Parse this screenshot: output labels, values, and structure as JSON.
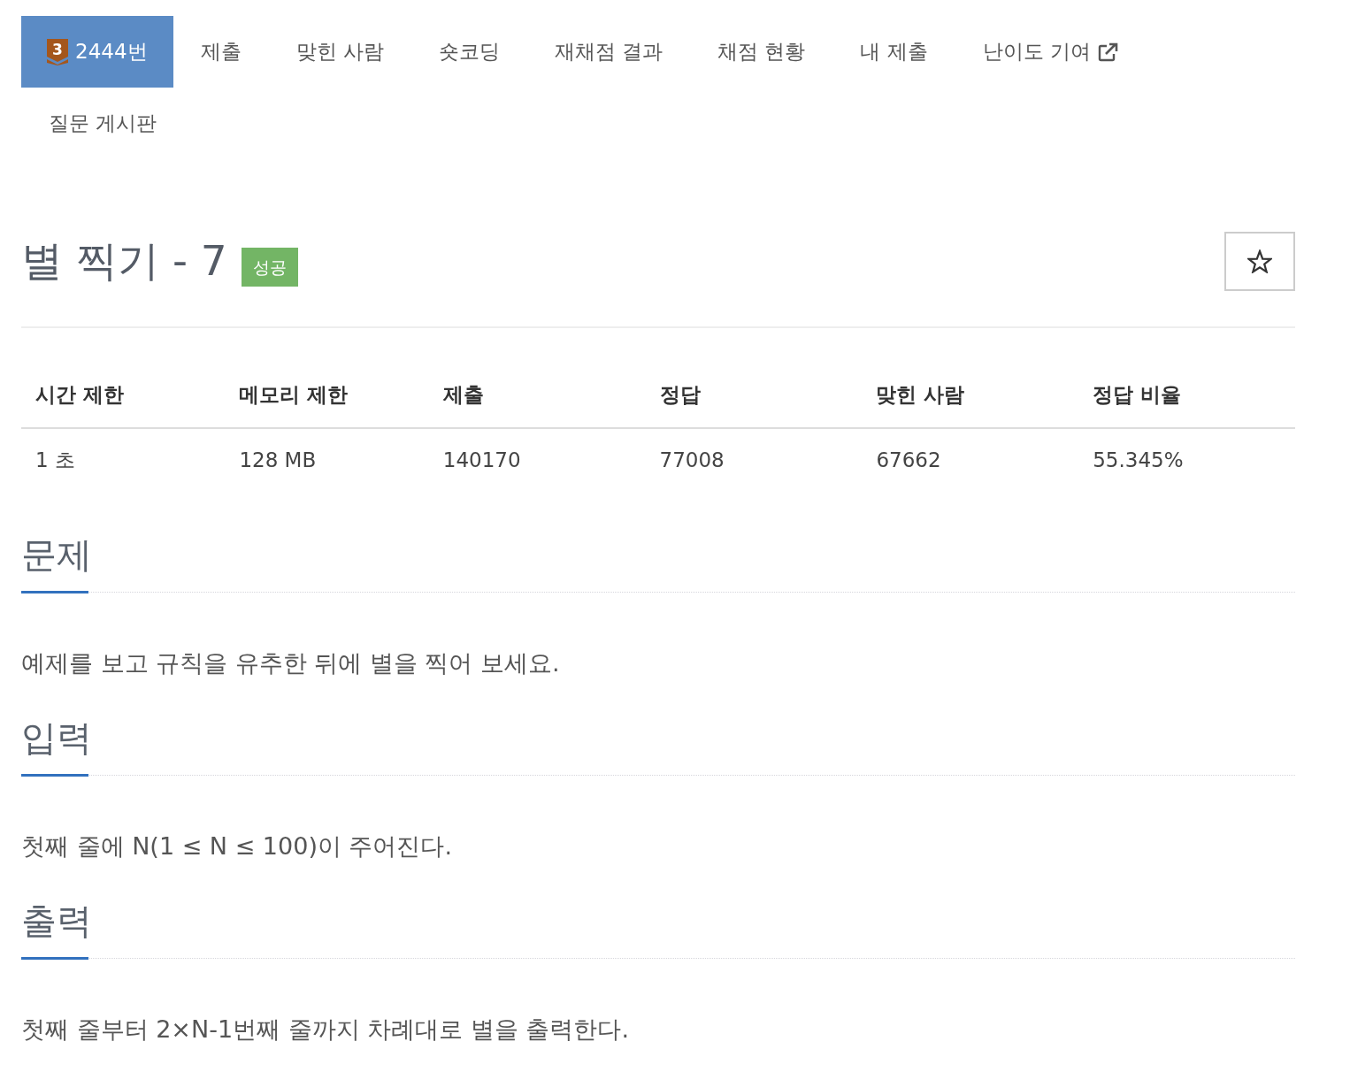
{
  "nav_tabs": [
    {
      "kind": "problem",
      "tier": "3",
      "label": "2444번",
      "selected": true,
      "external": false
    },
    {
      "kind": "link",
      "label": "제출",
      "selected": false,
      "external": false
    },
    {
      "kind": "link",
      "label": "맞힌 사람",
      "selected": false,
      "external": false
    },
    {
      "kind": "link",
      "label": "숏코딩",
      "selected": false,
      "external": false
    },
    {
      "kind": "link",
      "label": "재채점 결과",
      "selected": false,
      "external": false
    },
    {
      "kind": "link",
      "label": "채점 현황",
      "selected": false,
      "external": false
    },
    {
      "kind": "link",
      "label": "내 제출",
      "selected": false,
      "external": false
    },
    {
      "kind": "link",
      "label": "난이도 기여",
      "selected": false,
      "external": true
    },
    {
      "kind": "link",
      "label": "질문 게시판",
      "selected": false,
      "external": false
    }
  ],
  "problem": {
    "title": "별 찍기 - 7",
    "result": {
      "kind": "success",
      "label": "성공"
    },
    "starred": false
  },
  "stats": {
    "columns": [
      "시간 제한",
      "메모리 제한",
      "제출",
      "정답",
      "맞힌 사람",
      "정답 비율"
    ],
    "rows": [
      [
        "1 초",
        "128 MB",
        "140170",
        "77008",
        "67662",
        "55.345%"
      ]
    ]
  },
  "sections": [
    {
      "heading": "문제",
      "body": "예제를 보고 규칙을 유추한 뒤에 별을 찍어 보세요."
    },
    {
      "heading": "입력",
      "body": "첫째 줄에 N(1 ≤ N ≤ 100)이 주어진다."
    },
    {
      "heading": "출력",
      "body": "첫째 줄부터 2×N-1번째 줄까지 차례대로 별을 출력한다."
    }
  ]
}
